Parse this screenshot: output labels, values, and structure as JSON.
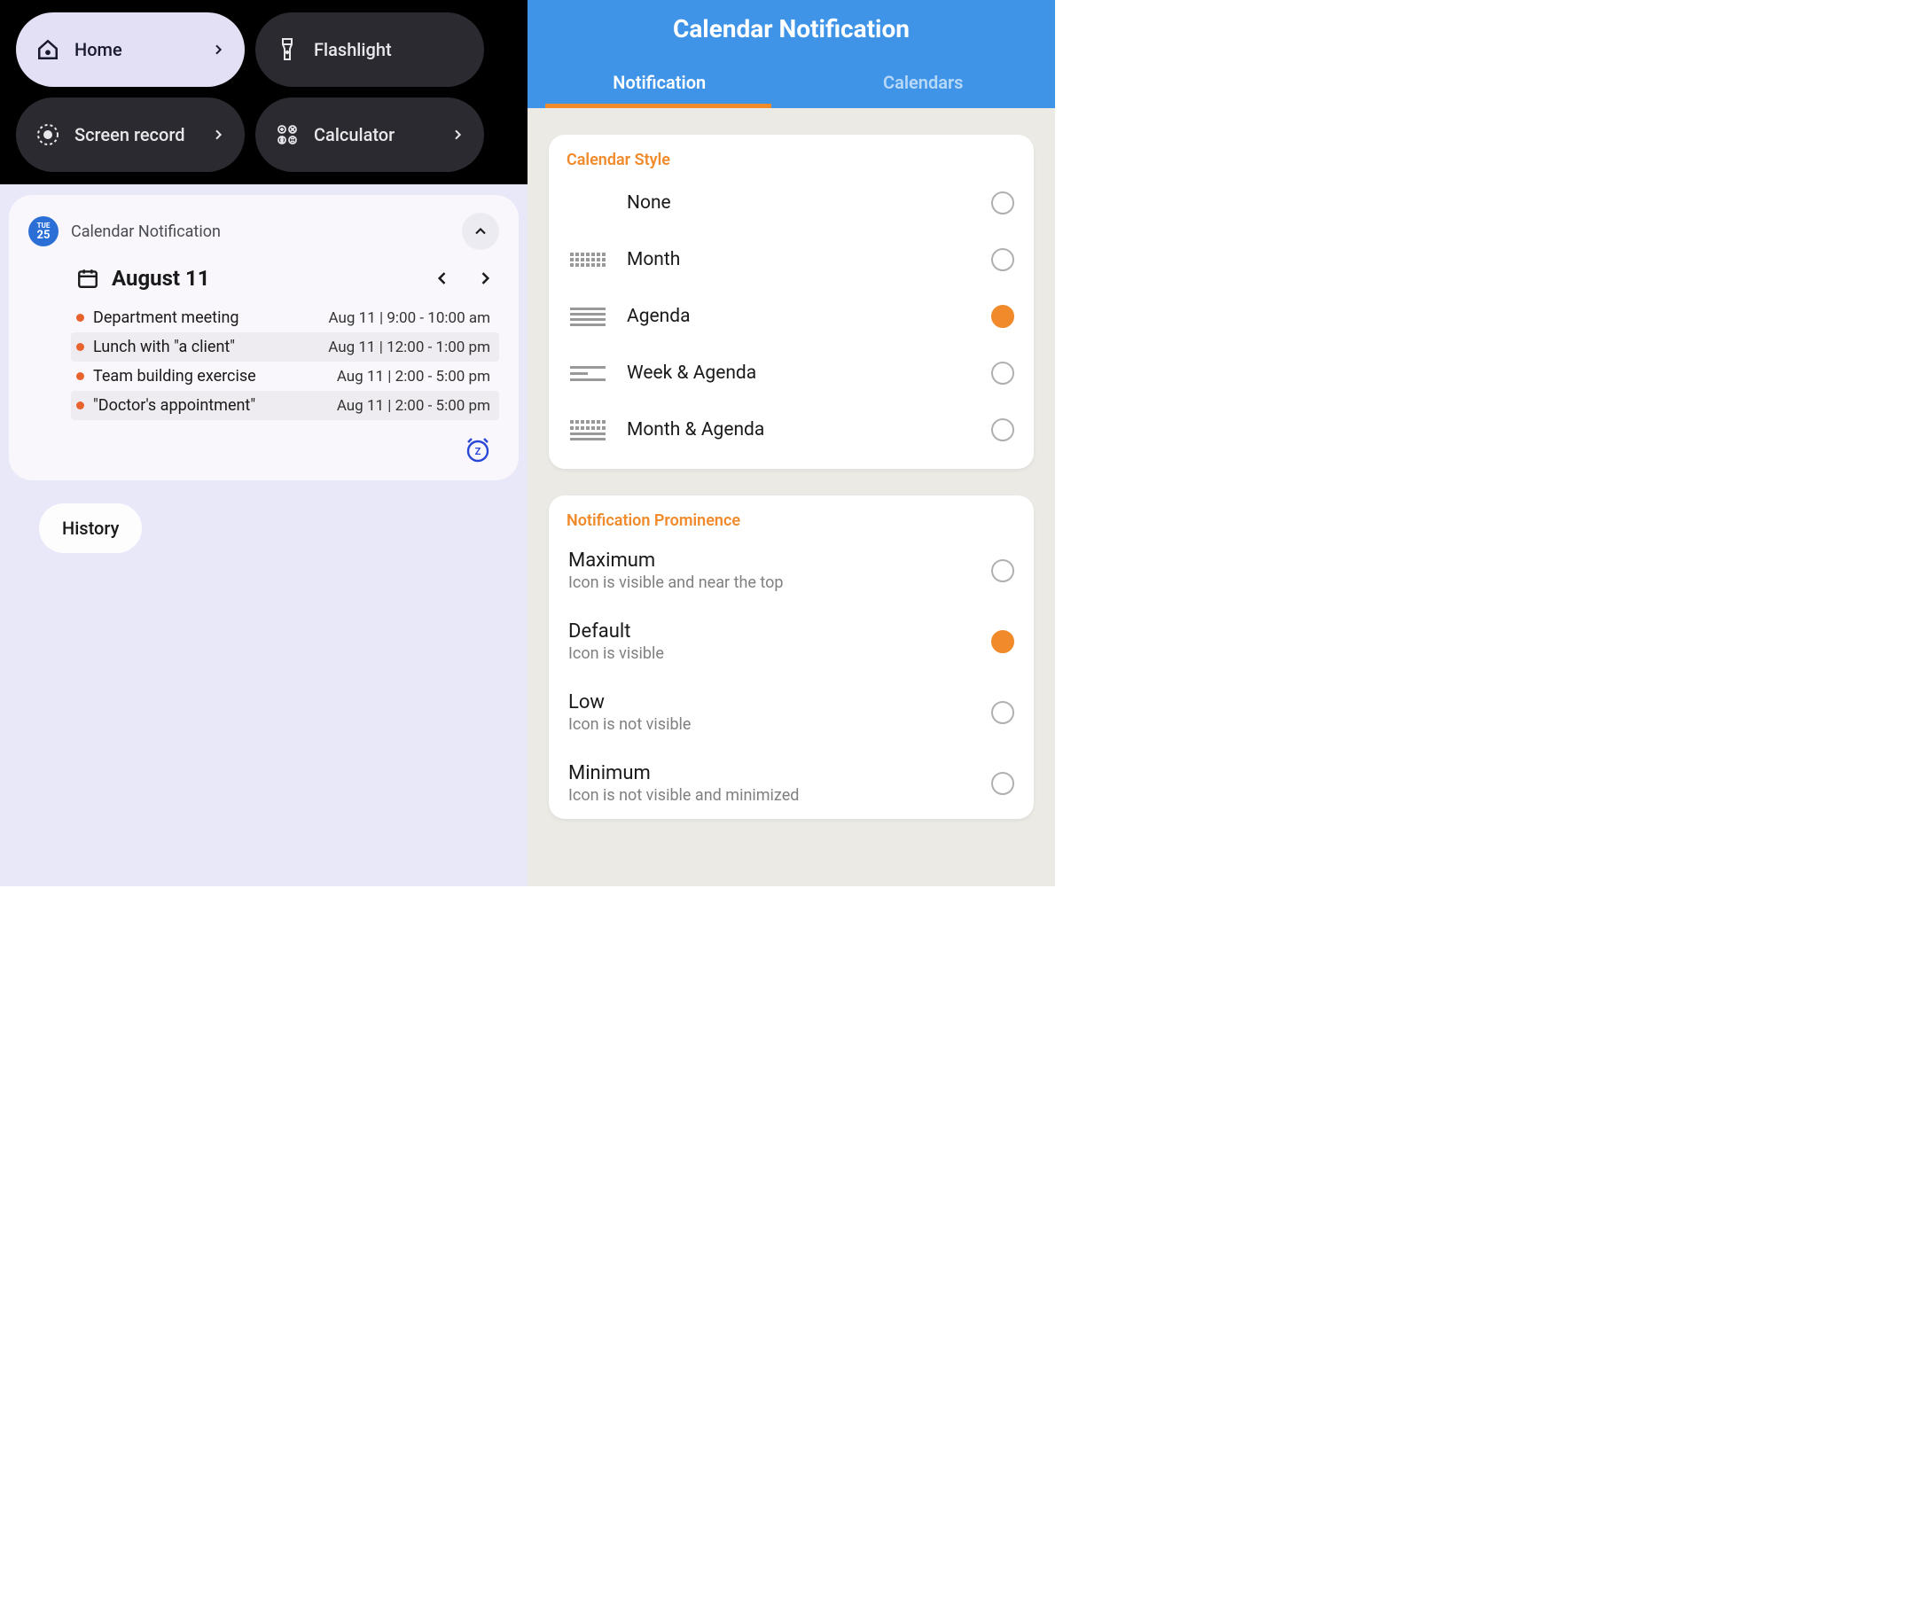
{
  "left": {
    "shortcuts": [
      {
        "label": "Home",
        "icon": "home-icon",
        "style": "light"
      },
      {
        "label": "Flashlight",
        "icon": "flashlight-icon",
        "style": "dark"
      },
      {
        "label": "Screen record",
        "icon": "screen-record-icon",
        "style": "dark"
      },
      {
        "label": "Calculator",
        "icon": "calculator-icon",
        "style": "dark"
      }
    ],
    "notification": {
      "badge_day_label": "TUE",
      "badge_day_num": "25",
      "app_title": "Calendar Notification",
      "date_label": "August 11",
      "events": [
        {
          "title": "Department meeting",
          "time": "Aug 11 | 9:00 - 10:00 am",
          "alt": false
        },
        {
          "title": "Lunch with \"a client\"",
          "time": "Aug 11 | 12:00 - 1:00 pm",
          "alt": true
        },
        {
          "title": "Team building exercise",
          "time": "Aug 11 | 2:00 - 5:00 pm",
          "alt": false
        },
        {
          "title": "\"Doctor's appointment\"",
          "time": "Aug 11 | 2:00 - 5:00 pm",
          "alt": true
        }
      ]
    },
    "history_label": "History"
  },
  "right": {
    "header_title": "Calendar Notification",
    "tabs": [
      {
        "label": "Notification",
        "active": true
      },
      {
        "label": "Calendars",
        "active": false
      }
    ],
    "calendar_style": {
      "title": "Calendar Style",
      "options": [
        {
          "label": "None",
          "icon": "none",
          "selected": false
        },
        {
          "label": "Month",
          "icon": "month",
          "selected": false
        },
        {
          "label": "Agenda",
          "icon": "agenda",
          "selected": true
        },
        {
          "label": "Week & Agenda",
          "icon": "week-agenda",
          "selected": false
        },
        {
          "label": "Month & Agenda",
          "icon": "month-agenda",
          "selected": false
        }
      ]
    },
    "prominence": {
      "title": "Notification Prominence",
      "options": [
        {
          "label": "Maximum",
          "sub": "Icon is visible and near the top",
          "selected": false
        },
        {
          "label": "Default",
          "sub": "Icon is visible",
          "selected": true
        },
        {
          "label": "Low",
          "sub": "Icon is not visible",
          "selected": false
        },
        {
          "label": "Minimum",
          "sub": "Icon is not visible and minimized",
          "selected": false
        }
      ]
    }
  }
}
